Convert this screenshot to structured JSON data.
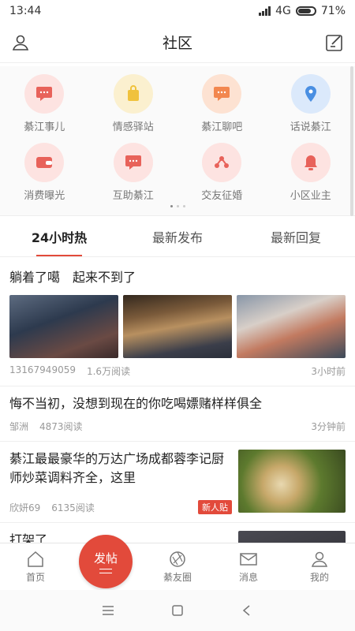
{
  "status_bar": {
    "time": "13:44",
    "network": "4G",
    "battery": "71%"
  },
  "header": {
    "title": "社区"
  },
  "categories": [
    {
      "label": "綦江事儿",
      "icon": "chat-icon",
      "color": "#e8625a",
      "bg": "#fde3e1"
    },
    {
      "label": "情感驿站",
      "icon": "bag-icon",
      "color": "#f0c23d",
      "bg": "#fbf0cf"
    },
    {
      "label": "綦江聊吧",
      "icon": "chat-icon",
      "color": "#f2874f",
      "bg": "#fde2d2"
    },
    {
      "label": "话说綦江",
      "icon": "location-icon",
      "color": "#4a8fe2",
      "bg": "#dbe9fb"
    },
    {
      "label": "消费曝光",
      "icon": "wallet-icon",
      "color": "#e8625a",
      "bg": "#fde3e1"
    },
    {
      "label": "互助綦江",
      "icon": "chat-icon",
      "color": "#e8625a",
      "bg": "#fde3e1"
    },
    {
      "label": "交友征婚",
      "icon": "share-icon",
      "color": "#e8625a",
      "bg": "#fde3e1"
    },
    {
      "label": "小区业主",
      "icon": "bell-icon",
      "color": "#e8625a",
      "bg": "#fde3e1"
    }
  ],
  "tabs": [
    {
      "label": "24小时热",
      "active": true
    },
    {
      "label": "最新发布",
      "active": false
    },
    {
      "label": "最新回复",
      "active": false
    }
  ],
  "posts": [
    {
      "title": "躺着了噶　起来不到了",
      "author": "13167949059",
      "reads": "1.6万阅读",
      "time": "3小时前"
    },
    {
      "title": "悔不当初，没想到现在的你吃喝嫖赌样样俱全",
      "author": "邹洲",
      "reads": "4873阅读",
      "time": "3分钟前"
    },
    {
      "title": "綦江最最豪华的万达广场成都蓉李记厨师炒菜调料齐全，这里",
      "author": "欣妍69",
      "reads": "6135阅读",
      "badge": "新人贴"
    },
    {
      "title": "打架了"
    }
  ],
  "bottom_nav": [
    {
      "label": "首页",
      "icon": "home-icon"
    },
    {
      "label": "綦友圈",
      "icon": "aperture-icon"
    },
    {
      "label": "消息",
      "icon": "mail-icon"
    },
    {
      "label": "我的",
      "icon": "user-icon"
    }
  ],
  "fab": {
    "label": "发帖"
  }
}
